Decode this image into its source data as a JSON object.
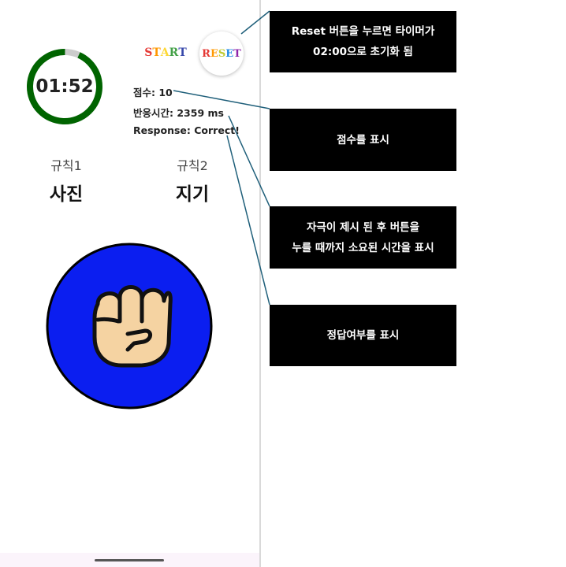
{
  "timer": {
    "display": "01:52",
    "progress": 0.933,
    "ring_color": "#006400",
    "track_color": "#cccccc"
  },
  "buttons": {
    "start": {
      "letters": [
        "S",
        "T",
        "A",
        "R",
        "T"
      ],
      "colors": [
        "#e53935",
        "#ff9800",
        "#fdd835",
        "#43a047",
        "#3949ab"
      ]
    },
    "reset": {
      "letters": [
        "R",
        "E",
        "S",
        "E",
        "T"
      ],
      "colors": [
        "#e53935",
        "#ff9800",
        "#c0ca33",
        "#1e88e5",
        "#8e24aa"
      ]
    }
  },
  "stats": {
    "score": "점수: 10",
    "reaction_time": "반응시간: 2359 ms",
    "response": "Response: Correct!"
  },
  "rules": [
    {
      "label": "규칙1",
      "value": "사진"
    },
    {
      "label": "규칙2",
      "value": "지기"
    }
  ],
  "stimulus": {
    "icon": "fist-icon",
    "background": "#0b1ef0"
  },
  "callouts": [
    {
      "lines": [
        "Reset 버튼을 누르면 타이머가",
        "02:00으로 초기화 됨"
      ]
    },
    {
      "lines": [
        "점수를 표시"
      ]
    },
    {
      "lines": [
        "자극이 제시 된 후 버튼을",
        "누를 때까지 소요된 시간을 표시"
      ]
    },
    {
      "lines": [
        "정답여부를 표시"
      ]
    }
  ],
  "colors": {
    "leader_line": "#1f5f7a"
  }
}
